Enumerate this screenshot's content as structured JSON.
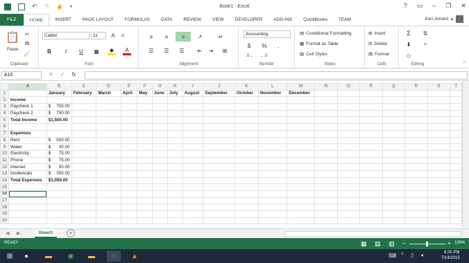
{
  "window": {
    "title": "Book1 - Excel",
    "user": "Kari Jonard"
  },
  "tabs": [
    "FILE",
    "HOME",
    "INSERT",
    "PAGE LAYOUT",
    "FORMULAS",
    "DATA",
    "REVIEW",
    "VIEW",
    "DEVELOPER",
    "ADD-INS",
    "QuickBooks",
    "TEAM"
  ],
  "ribbon": {
    "clipboard": {
      "label": "Clipboard",
      "paste": "Paste"
    },
    "font": {
      "label": "Font",
      "name": "Calibri",
      "size": "11",
      "bold": "B",
      "italic": "I",
      "underline": "U"
    },
    "alignment": {
      "label": "Alignment"
    },
    "number": {
      "label": "Number",
      "format": "Accounting",
      "currency": "$",
      "percent": "%",
      "comma": ","
    },
    "styles": {
      "label": "Styles",
      "conditional": "Conditional Formatting",
      "table": "Format as Table",
      "cell": "Cell Styles"
    },
    "cells": {
      "label": "Cells",
      "insert": "Insert",
      "delete": "Delete",
      "format": "Format"
    },
    "editing": {
      "label": "Editing"
    }
  },
  "formula_bar": {
    "name_box": "A16",
    "fx": "fx",
    "cancel": "✕",
    "enter": "✓",
    "formula": ""
  },
  "columns": [
    "A",
    "B",
    "C",
    "D",
    "E",
    "F",
    "G",
    "H",
    "I",
    "J",
    "K",
    "L",
    "M",
    "N",
    "O",
    "P",
    "Q",
    "R",
    "S",
    "T"
  ],
  "cells": [
    [
      "",
      "January",
      "February",
      "March",
      "April",
      "May",
      "June",
      "July",
      "August",
      "September",
      "October",
      "November",
      "December"
    ],
    [
      "Income"
    ],
    [
      "Paycheck 1",
      "$ 750.00"
    ],
    [
      "Paycheck 2",
      "$ 750.00"
    ],
    [
      "Total Income",
      "$1,500.00"
    ],
    [
      ""
    ],
    [
      "Expenses"
    ],
    [
      "Rent",
      "$ 500.00"
    ],
    [
      "Water",
      "$ 30.00"
    ],
    [
      "Electricity",
      "$ 75.00"
    ],
    [
      "Phone",
      "$ 75.00"
    ],
    [
      "Internet",
      "$ 50.00"
    ],
    [
      "Incidencals",
      "$ 300.00"
    ],
    [
      "Total Expenses",
      "$1,050.00"
    ],
    [
      ""
    ],
    [
      ""
    ],
    [
      ""
    ],
    [
      ""
    ],
    [
      ""
    ],
    [
      ""
    ]
  ],
  "bold_rows": [
    1,
    2,
    5,
    7,
    14
  ],
  "selected_cell": "A16",
  "sheet": {
    "name": "Sheet1",
    "add": "+"
  },
  "status": {
    "mode": "READY",
    "zoom": "100%"
  },
  "taskbar": {
    "time": "8:20 PM",
    "date": "7/14/2015"
  },
  "colors": {
    "accent": "#217346",
    "taskbar": "#1c2a3a"
  }
}
